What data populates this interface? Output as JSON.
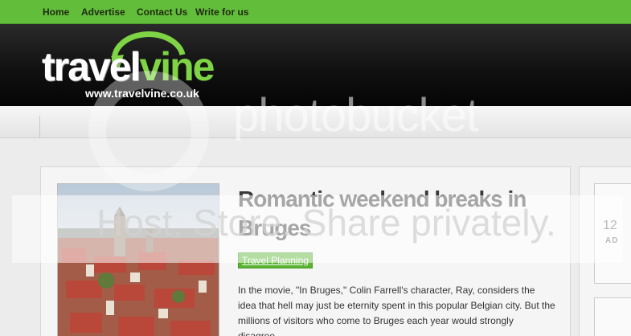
{
  "nav": {
    "items": [
      {
        "label": "Home"
      },
      {
        "label": "Advertise"
      },
      {
        "label": "Contact Us"
      },
      {
        "label": "Write for us"
      }
    ]
  },
  "brand": {
    "name_part1": "travel",
    "name_part2": "vine",
    "url": "www.travelvine.co.uk",
    "accent_color": "#62bd3a"
  },
  "article": {
    "title": "Romantic weekend breaks in Bruges",
    "category": "Travel Planning",
    "excerpt": "In the movie, \"In Bruges,\" Colin Farrell's character, Ray, considers the idea that hell may just be eternity spent in this popular Belgian city. But the millions of visitors who come to Bruges each year would strongly disagree."
  },
  "sidebar": {
    "number": "12",
    "label": "AD"
  },
  "watermark": {
    "brand": "photobucket",
    "tagline": "Host. Store. Share privately."
  }
}
